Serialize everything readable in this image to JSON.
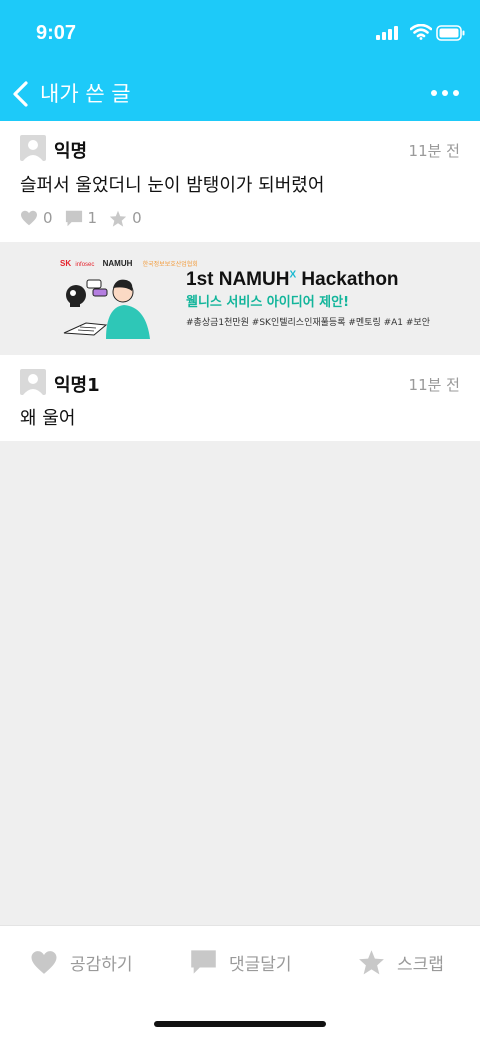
{
  "status": {
    "time": "9:07",
    "colors": {
      "brand": "#1dcaf9",
      "muted": "#9a9a9a"
    }
  },
  "nav": {
    "title": "내가 쓴 글",
    "back_icon": "chevron-left-icon",
    "more_icon": "more-horizontal-icon"
  },
  "posts": [
    {
      "author": "익명",
      "time": "11분 전",
      "text": "슬퍼서 울었더니 눈이 밤탱이가 되버렸어",
      "likes": "0",
      "comments": "1",
      "scraps": "0"
    },
    {
      "author": "익명1",
      "time": "11분 전",
      "text": "왜 울어"
    }
  ],
  "banner": {
    "brand_sk": "SK",
    "brand_sk_sub": "infosec",
    "brand_namuh": "NAMUH",
    "brand_partner": "한국정보보호산업협회",
    "title": "1st NAMUH",
    "title_sup": "X",
    "title_rest": " Hackathon",
    "subtitle": "웰니스 서비스 아이디어 제안!",
    "tags": "#총상금1천만원 #SK인텔리스인재풀등록 #멘토링 #A1 #보안"
  },
  "tabs": {
    "like": "공감하기",
    "comment": "댓글달기",
    "scrap": "스크랩"
  }
}
